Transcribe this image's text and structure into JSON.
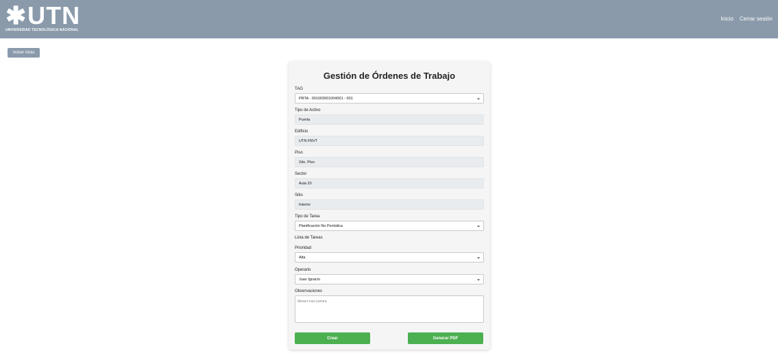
{
  "header": {
    "logo_mark": "✱",
    "logo_text": "UTN",
    "logo_subtitle": "UNIVERSIDAD TECNOLÓGICA NACIONAL",
    "nav": {
      "inicio": "Inicio",
      "cerrar_sesion": "Cerrar sesión"
    },
    "background_color": "#8a9aab"
  },
  "back_button": "Volver Atrás",
  "form": {
    "title": "Gestión de Órdenes de Trabajo",
    "tag": {
      "label": "TAG",
      "value": "PRTA - 001003001004001 - 001"
    },
    "tipo_activo": {
      "label": "Tipo de Activo",
      "value": "Puerta"
    },
    "edificio": {
      "label": "Edificio",
      "value": "UTN FRVT"
    },
    "piso": {
      "label": "Piso",
      "value": "2do. Piso"
    },
    "sector": {
      "label": "Sector",
      "value": "Aula 20"
    },
    "sitio": {
      "label": "Sitio",
      "value": "Interior"
    },
    "tipo_tarea": {
      "label": "Tipo de Tarea",
      "value": "Planificación No Periódica"
    },
    "lista_tareas": {
      "label": "Lista de Tareas"
    },
    "prioridad": {
      "label": "Prioridad",
      "value": "Alta"
    },
    "operario": {
      "label": "Operario",
      "value": "Juan Ignacio"
    },
    "observaciones": {
      "label": "Observaciones",
      "placeholder": "Observaciones"
    },
    "crear_label": "Crear",
    "pdf_label": "Generar PDF",
    "button_color": "#4caf50"
  },
  "icons": {
    "select_arrow": "chevron-down-icon"
  }
}
